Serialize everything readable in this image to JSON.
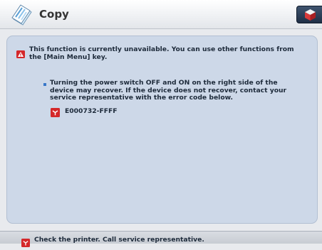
{
  "app": {
    "title": "Copy",
    "icon": "copy-paper-icon",
    "status_button_icon": "status-monitor-cube-icon"
  },
  "message": {
    "icon": "warning-triangle-icon",
    "text": "This function is currently unavailable. You can use other functions from the [Main Menu] key.",
    "detail": "Turning the power switch OFF and ON on the right side of the device may recover. If the device does not recover, contact your service representative with the error code below.",
    "error_code_icon": "service-error-icon",
    "error_code": "E000732-FFFF"
  },
  "status": {
    "icon": "service-error-icon",
    "text": "Check the printer. Call service representative."
  },
  "colors": {
    "panel": "#cdd8e8",
    "accent_red": "#d4282a",
    "bullet": "#3877c8",
    "status_button": "#2a3d56"
  }
}
